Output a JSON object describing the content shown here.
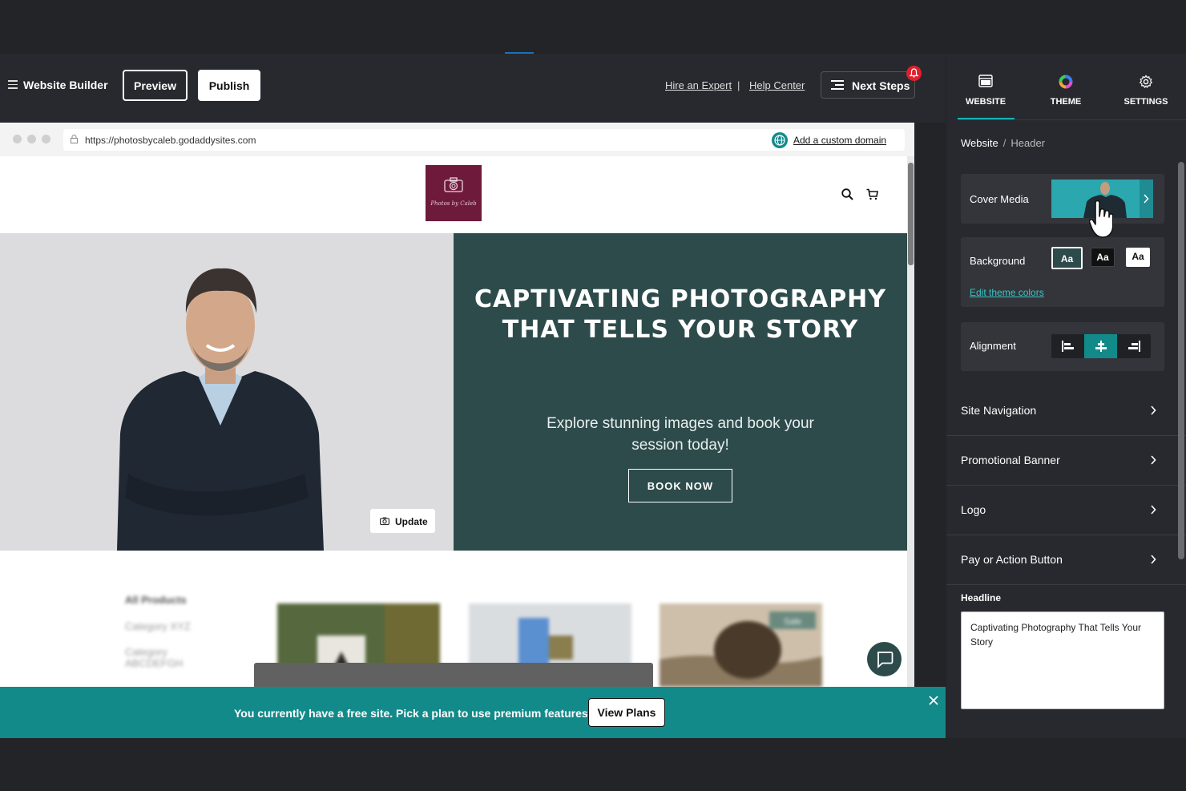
{
  "toolbar": {
    "app_title": "Website Builder",
    "preview_label": "Preview",
    "publish_label": "Publish",
    "hire_link": "Hire an Expert",
    "separator": "|",
    "help_link": "Help Center",
    "next_steps_label": "Next Steps"
  },
  "browser": {
    "url": "https://photosbycaleb.godaddysites.com",
    "custom_domain_link": "Add a custom domain"
  },
  "site": {
    "logo_text": "Photos by Caleb",
    "hero_title": "CAPTIVATING PHOTOGRAPHY THAT TELLS YOUR STORY",
    "hero_subtitle": "Explore stunning images and book your session today!",
    "book_button": "BOOK NOW",
    "update_button": "Update",
    "products_heading": "All Products",
    "category_1": "Category XYZ",
    "category_2": "Category ABCDEFGH",
    "sale_badge": "Sale"
  },
  "banner": {
    "message": "You currently have a free site. Pick a plan to use premium features.",
    "plans_button": "View Plans"
  },
  "panel": {
    "tabs": [
      {
        "label": "WEBSITE",
        "icon": "website-icon"
      },
      {
        "label": "THEME",
        "icon": "theme-icon"
      },
      {
        "label": "SETTINGS",
        "icon": "gear-icon"
      }
    ],
    "breadcrumb": {
      "root": "Website",
      "sep": "/",
      "current": "Header"
    },
    "cover_media_label": "Cover Media",
    "background_label": "Background",
    "background_swatches": [
      "Aa",
      "Aa",
      "Aa"
    ],
    "edit_colors_link": "Edit theme colors",
    "alignment_label": "Alignment",
    "alignment_selected": "center",
    "sections": [
      "Site Navigation",
      "Promotional Banner",
      "Logo",
      "Pay or Action Button"
    ],
    "headline_label": "Headline",
    "headline_value": "Captivating Photography That Tells Your Story"
  },
  "colors": {
    "accent": "#138a8a",
    "hero_bg": "#2e4b4b",
    "logo_bg": "#6e1a3a",
    "notification": "#e0202e"
  }
}
